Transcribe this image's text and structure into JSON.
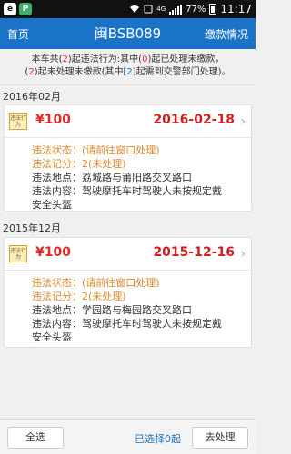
{
  "status_bar": {
    "app1": "e",
    "app2": "P",
    "network": "4G",
    "battery": "77%",
    "time": "11:17"
  },
  "header": {
    "back_label": "首页",
    "title": "闽BSB089",
    "right_label": "缴款情况"
  },
  "summary": {
    "p1": "本车共(",
    "n1": "2",
    "p2": ")起违法行为:其中(",
    "n2": "0",
    "p3": ")起已处理未缴款，",
    "p4": "(",
    "n3": "2",
    "p5": ")起未处理未缴款(其中[",
    "n4": "2",
    "p6": "]起需到交警部门处理)。"
  },
  "violations": [
    {
      "month": "2016年02月",
      "stamp": "违法行为",
      "amount": "¥100",
      "date": "2016-02-18",
      "status": "违法状态：(请前往窗口处理)",
      "points": "违法记分：2(未处理)",
      "location": "违法地点：荔城路与莆阳路交叉路口",
      "content_line1": "违法内容：驾驶摩托车时驾驶人未按规定戴",
      "content_line2": "安全头盔"
    },
    {
      "month": "2015年12月",
      "stamp": "违法行为",
      "amount": "¥100",
      "date": "2015-12-16",
      "status": "违法状态：(请前往窗口处理)",
      "points": "违法记分：2(未处理)",
      "location": "违法地点：学园路与梅园路交叉路口",
      "content_line1": "违法内容：驾驶摩托车时驾驶人未按规定戴",
      "content_line2": "安全头盔"
    }
  ],
  "footer": {
    "select_all": "全选",
    "selected_text": "已选择0起",
    "pay_button": "去处理"
  },
  "colors": {
    "header_bg": "#1b73c7",
    "amount": "#e52929",
    "status": "#e0882a"
  }
}
